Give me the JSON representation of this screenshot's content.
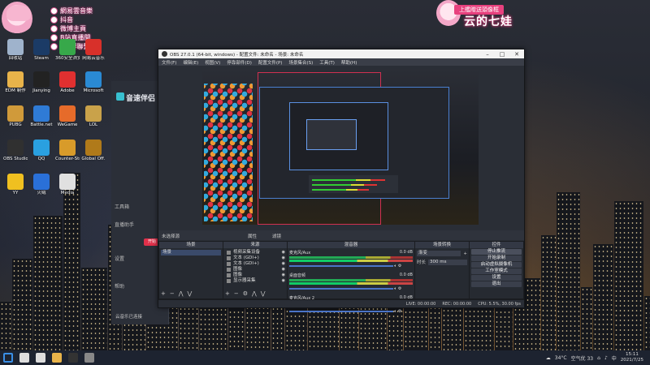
{
  "stream_overlay": {
    "lines": [
      "網易雲音樂",
      "抖音",
      "微博主頁",
      "B站直播間",
      "QQ群聯繫"
    ],
    "top_right_banner": "上艦贈送頭像框",
    "top_right_name": "云的七娃"
  },
  "desktop_icons": [
    {
      "label": "回收站",
      "icon": "recycle-bin-icon",
      "color": "#9fb3cc"
    },
    {
      "label": "Steam",
      "icon": "steam-icon",
      "color": "#1b3b66"
    },
    {
      "label": "360安全浏览",
      "icon": "browser-360-icon",
      "color": "#37a84a"
    },
    {
      "label": "网易云音乐",
      "icon": "netease-music-icon",
      "color": "#d8302a"
    },
    {
      "label": "EDM 制作",
      "icon": "folder-icon",
      "color": "#e8b34a"
    },
    {
      "label": "Jianying",
      "icon": "jianying-icon",
      "color": "#222"
    },
    {
      "label": "Adobe",
      "icon": "adobe-icon",
      "color": "#e03030"
    },
    {
      "label": "Microsoft",
      "icon": "edge-icon",
      "color": "#2a8ad4"
    },
    {
      "label": "PUBG",
      "icon": "pubg-icon",
      "color": "#d09a3a"
    },
    {
      "label": "Battle.net",
      "icon": "battlenet-icon",
      "color": "#2f7bd6"
    },
    {
      "label": "WeGame",
      "icon": "wegame-icon",
      "color": "#e66b2a"
    },
    {
      "label": "LOL",
      "icon": "lol-icon",
      "color": "#c9a24a"
    },
    {
      "label": "OBS Studio",
      "icon": "obs-icon",
      "color": "#303030"
    },
    {
      "label": "QQ",
      "icon": "qq-icon",
      "color": "#2aa0e0"
    },
    {
      "label": "Counter-Strike",
      "icon": "csgo-icon",
      "color": "#d89b2a"
    },
    {
      "label": "Global Off.",
      "icon": "csgo-icon",
      "color": "#b07a1a"
    },
    {
      "label": "YY",
      "icon": "yy-icon",
      "color": "#f0c020"
    },
    {
      "label": "火绒",
      "icon": "shield-icon",
      "color": "#2a70d8"
    },
    {
      "label": "Media",
      "icon": "media-icon",
      "color": "#e0e0e0"
    }
  ],
  "bg_app": {
    "title": "音速伴侣",
    "items": [
      "工具箱",
      "直播助手",
      "设置",
      "帮助"
    ],
    "button": "开始",
    "footer": "云音乐已连接"
  },
  "obs": {
    "title": "OBS 27.0.1 (64-bit, windows) - 配置文件: 未命名 - 场景: 未命名",
    "menu": [
      "文件(F)",
      "编辑(E)",
      "视图(V)",
      "停靠部件(D)",
      "配置文件(P)",
      "场景集合(S)",
      "工具(T)",
      "帮助(H)"
    ],
    "preview_tabs": [
      "未选择源"
    ],
    "preview_props": "属性",
    "preview_filters": "滤镜",
    "docks": {
      "scenes": {
        "title": "场景",
        "items": [
          "场景"
        ]
      },
      "sources": {
        "title": "来源",
        "items": [
          "视频采集设备",
          "文本 (GDI+)",
          "文本 (GDI+)",
          "图像",
          "图像",
          "显示器采集"
        ]
      },
      "mixer": {
        "title": "混音器",
        "channels": [
          {
            "name": "麦克风/Aux",
            "db": "0.0 dB"
          },
          {
            "name": "桌面音频",
            "db": "0.0 dB"
          },
          {
            "name": "麦克风/Aux 2",
            "db": "0.0 dB"
          }
        ]
      },
      "transitions": {
        "title": "场景转换",
        "select": "渐变",
        "duration_label": "时长",
        "duration": "300 ms"
      },
      "controls": {
        "title": "控件",
        "buttons": [
          "停止推流",
          "开始录制",
          "启动虚拟摄像机",
          "工作室模式",
          "设置",
          "退出"
        ]
      }
    },
    "status": [
      "LIVE: 00:00:00",
      "REC: 00:00:00",
      "CPU: 5.5%, 30.00 fps"
    ]
  },
  "taskbar": {
    "icons": [
      "start-icon",
      "search-icon",
      "taskview-icon",
      "explorer-icon",
      "obs-icon",
      "media-icon"
    ],
    "weather": "34°C",
    "weather_text": "空气优 33",
    "ime": "中",
    "time": "15:11",
    "date": "2021/7/25"
  }
}
